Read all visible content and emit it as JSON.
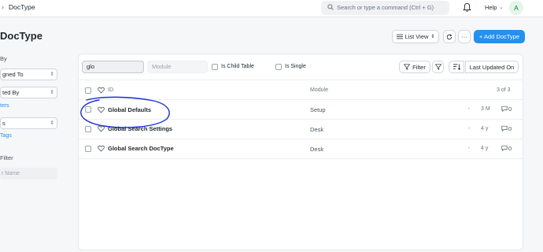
{
  "navbar": {
    "breadcrumb": "DocType",
    "search_placeholder": "Search or type a command (Ctrl + G)",
    "help_label": "Help",
    "avatar_initial": "A"
  },
  "page": {
    "title": "DocType",
    "list_view_label": "List View",
    "more_label": "···",
    "add_label": "+ Add DocType"
  },
  "sidebar": {
    "heading_by": "By",
    "assigned_to": "gned To",
    "created_by": "ted By",
    "show_filters": "ters",
    "tags_select": "s",
    "show_tags": "Tags",
    "filter_heading": "Filter",
    "filter_placeholder": "r Name"
  },
  "filters": {
    "id_value": "glo",
    "module_placeholder": "Module",
    "is_child_table": "Is Child Table",
    "is_single": "Is Single",
    "filter_label": "Filter",
    "sort_label": "Last Updated On"
  },
  "table": {
    "col_id": "ID",
    "col_module": "Module",
    "count": "3 of 3",
    "rows": [
      {
        "name": "Global Defaults",
        "module": "Setup",
        "dash": "-",
        "time": "3 M",
        "comments": "0"
      },
      {
        "name": "Global Search Settings",
        "module": "Desk",
        "dash": "-",
        "time": "4 y",
        "comments": "0"
      },
      {
        "name": "Global Search DocType",
        "module": "Desk",
        "dash": "-",
        "time": "4 y",
        "comments": "0"
      }
    ]
  },
  "colors": {
    "primary": "#2490ef",
    "annotation": "#1a2fd1"
  }
}
